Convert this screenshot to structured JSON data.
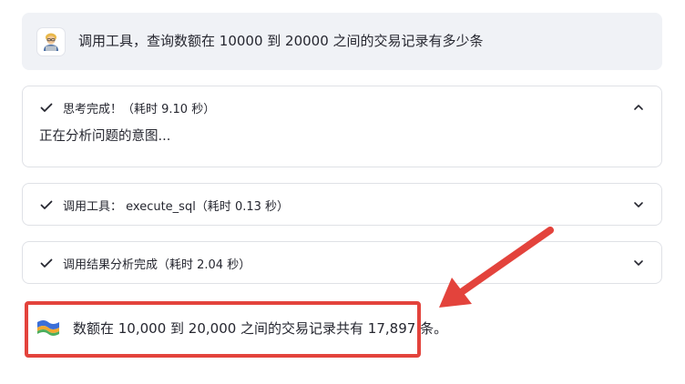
{
  "user_message": {
    "avatar_icon": "technologist-avatar-icon",
    "text": "调用工具，查询数额在 10000 到 20000 之间的交易记录有多少条"
  },
  "steps": [
    {
      "label": "思考完成！（耗时 9.10 秒）",
      "expanded": true,
      "body": "正在分析问题的意图..."
    },
    {
      "label": "调用工具： execute_sql（耗时 0.13 秒）",
      "expanded": false
    },
    {
      "label": "调用结果分析完成（耗时 2.04 秒）",
      "expanded": false
    }
  ],
  "answer": {
    "avatar_icon": "bot-avatar-icon",
    "text": "数额在 10,000 到 20,000 之间的交易记录共有 17,897 条。"
  },
  "colors": {
    "user_bg": "#f0f2f6",
    "border": "#dfe1e6",
    "annotation_red": "#e3433c",
    "check_color": "#262730"
  }
}
